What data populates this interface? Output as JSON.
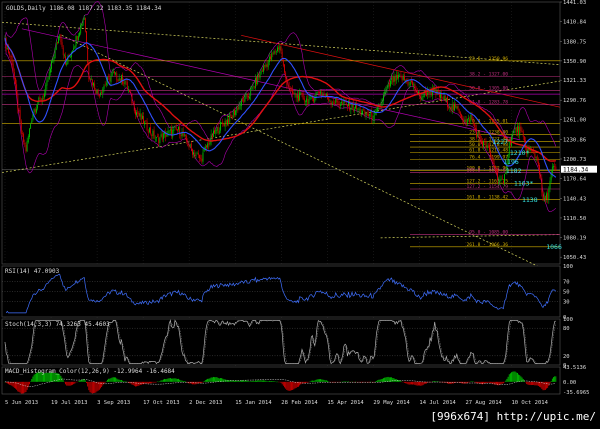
{
  "window": {
    "symbol_line": "GOLDS,Daily  1186.08 1187.22 1183.35 1184.34",
    "current_price_tag": "1184.34"
  },
  "indicators": {
    "rsi_label": "RSI(14) 47.0903",
    "stoch_label": "Stoch(14,3,3) 74.3263 45.4603",
    "macd_label": "MACD_Histogram_Color(12,26,9) -12.9964 -16.4684"
  },
  "colors": {
    "background": "#000000",
    "grid": "#3a3a3a",
    "bull_candle": "#00c800",
    "bear_candle": "#e00000",
    "ma_red": "#e01010",
    "ma_blue": "#3050ff",
    "bollinger": "#b000b0",
    "fib_gold": "#d4b000",
    "fib_mag": "#c03080",
    "channel_yellow": "#d8d860",
    "cyan_label": "#33e0e0",
    "rsi_line": "#4070ff",
    "stoch_main": "#b0b0b0",
    "macd_pos": "#00d000",
    "macd_neg": "#e00000",
    "scale_text": "#dddddd",
    "price_tag_bg": "#ffffff"
  },
  "price_axis": {
    "ticks": [
      "1441.03",
      "1410.84",
      "1380.75",
      "1350.90",
      "1321.33",
      "1290.76",
      "1261.00",
      "1230.86",
      "1200.73",
      "1170.64",
      "1140.43",
      "1110.50",
      "1080.19",
      "1050.43"
    ]
  },
  "rsi_axis": {
    "ticks": [
      "100",
      "70",
      "50",
      "30",
      "0"
    ]
  },
  "stoch_axis": {
    "ticks": [
      "100",
      "80",
      "20",
      "0"
    ]
  },
  "macd_axis": {
    "ticks": [
      "43.5136",
      "0.00",
      "-35.6965"
    ]
  },
  "time_axis": {
    "ticks": [
      "5 Jun 2013",
      "19 Jul 2013",
      "3 Sep 2013",
      "17 Oct 2013",
      "2 Dec 2013",
      "15 Jan 2014",
      "28 Feb 2014",
      "15 Apr 2014",
      "29 May 2014",
      "14 Jul 2014",
      "27 Aug 2014",
      "10 Oct 2014"
    ]
  },
  "fib_levels": [
    {
      "label": "23.6 - 1350.96",
      "price": 1350.96,
      "color": "gold"
    },
    {
      "label": "0.0 - 1255.01",
      "price": 1255.01,
      "color": "gold"
    },
    {
      "label": "23.6 - 1238.00",
      "price": 1238.0,
      "color": "gold"
    },
    {
      "label": "38.2 - 1227.48",
      "price": 1227.48,
      "color": "gold"
    },
    {
      "label": "50.0 - 1218.98",
      "price": 1218.98,
      "color": "gold"
    },
    {
      "label": "61.8 - 1210.48",
      "price": 1210.48,
      "color": "gold"
    },
    {
      "label": "76.4 - 1199.97",
      "price": 1199.97,
      "color": "gold"
    },
    {
      "label": "100.0 - 1182.96",
      "price": 1182.96,
      "color": "gold"
    },
    {
      "label": "127.2 - 1163.35",
      "price": 1163.35,
      "color": "gold"
    },
    {
      "label": "161.8 - 1138.42",
      "price": 1138.42,
      "color": "gold"
    },
    {
      "label": "261.8 - 1066.36",
      "price": 1066.36,
      "color": "gold"
    },
    {
      "label": "50.0 - 1305.80",
      "price": 1305.8,
      "color": "mag"
    },
    {
      "label": "61.8 - 1283.78",
      "price": 1283.78,
      "color": "mag"
    },
    {
      "label": "38.2 - 1327.00",
      "price": 1327.0,
      "color": "mag"
    },
    {
      "label": "100.0 - 1180.14",
      "price": 1180.14,
      "color": "mag"
    },
    {
      "label": "127.2 - 1154.79",
      "price": 1154.79,
      "color": "mag"
    },
    {
      "label": "95.0 - 1085.00",
      "price": 1085.0,
      "color": "mag"
    }
  ],
  "cyan_labels": [
    {
      "text": "1227",
      "price": 1227,
      "day": 362
    },
    {
      "text": "1210*",
      "price": 1210,
      "day": 375
    },
    {
      "text": "1196",
      "price": 1196,
      "day": 370
    },
    {
      "text": "1182",
      "price": 1182,
      "day": 372
    },
    {
      "text": "1163*",
      "price": 1163,
      "day": 378
    },
    {
      "text": "1138",
      "price": 1138,
      "day": 384
    },
    {
      "text": "1066",
      "price": 1066,
      "day": 402
    }
  ],
  "watermark": "[996x674] http://upic.me/"
}
